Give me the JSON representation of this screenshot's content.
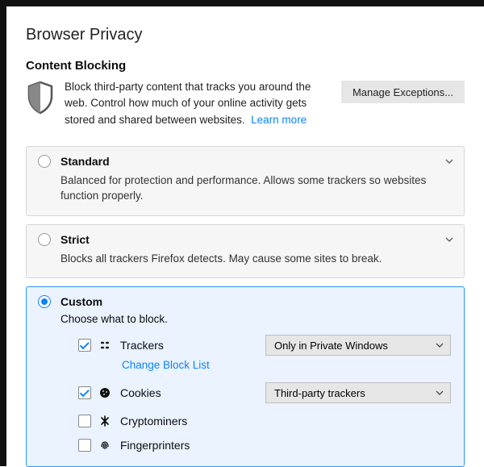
{
  "page_title": "Browser Privacy",
  "content_blocking": {
    "heading": "Content Blocking",
    "description_part1": "Block third-party content that tracks you around the web. Control how much of your online activity gets stored and shared between websites.",
    "learn_more": "Learn more",
    "manage_exceptions": "Manage Exceptions..."
  },
  "options": {
    "standard": {
      "title": "Standard",
      "description": "Balanced for protection and performance. Allows some trackers so websites function properly."
    },
    "strict": {
      "title": "Strict",
      "description": "Blocks all trackers Firefox detects. May cause some sites to break."
    },
    "custom": {
      "title": "Custom",
      "subtitle": "Choose what to block.",
      "items": {
        "trackers": {
          "label": "Trackers",
          "checked": true,
          "dropdown": "Only in Private Windows",
          "change_block_list": "Change Block List"
        },
        "cookies": {
          "label": "Cookies",
          "checked": true,
          "dropdown": "Third-party trackers"
        },
        "cryptominers": {
          "label": "Cryptominers",
          "checked": false
        },
        "fingerprinters": {
          "label": "Fingerprinters",
          "checked": false
        }
      },
      "selected": true
    }
  }
}
